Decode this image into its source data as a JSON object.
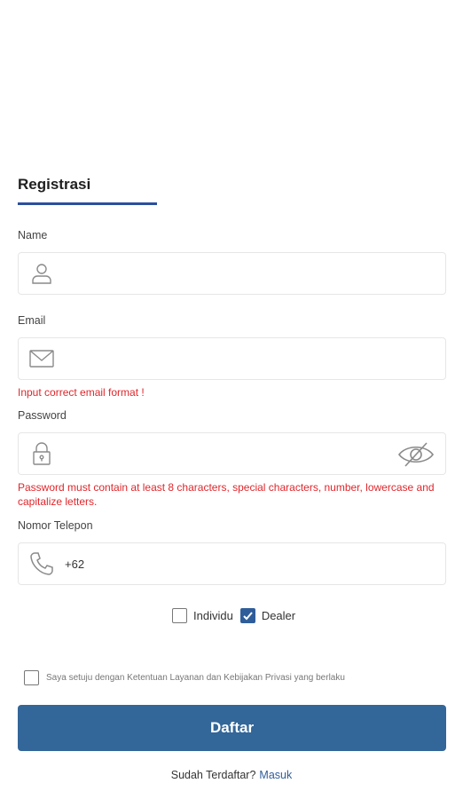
{
  "form": {
    "title": "Registrasi",
    "name": {
      "label": "Name",
      "value": ""
    },
    "email": {
      "label": "Email",
      "value": "",
      "error": "Input correct email format !"
    },
    "password": {
      "label": "Password",
      "value": "",
      "error": "Password must contain at least 8 characters, special characters, number, lowercase and capitalize letters."
    },
    "phone": {
      "label": "Nomor Telepon",
      "value": "+62"
    },
    "roles": [
      {
        "label": "Individu",
        "checked": false
      },
      {
        "label": "Dealer",
        "checked": true
      }
    ],
    "agreement": {
      "label": "Saya setuju dengan Ketentuan Layanan dan Kebijakan Privasi yang berlaku",
      "checked": false
    },
    "submit_label": "Daftar",
    "login_prompt": "Sudah Terdaftar?",
    "login_link": "Masuk"
  },
  "icons": [
    "user-icon",
    "mail-icon",
    "lock-icon",
    "eye-off-icon",
    "phone-icon",
    "check-icon"
  ],
  "colors": {
    "accent": "#2c4f9e",
    "button": "#336699",
    "error": "#e0262b"
  }
}
